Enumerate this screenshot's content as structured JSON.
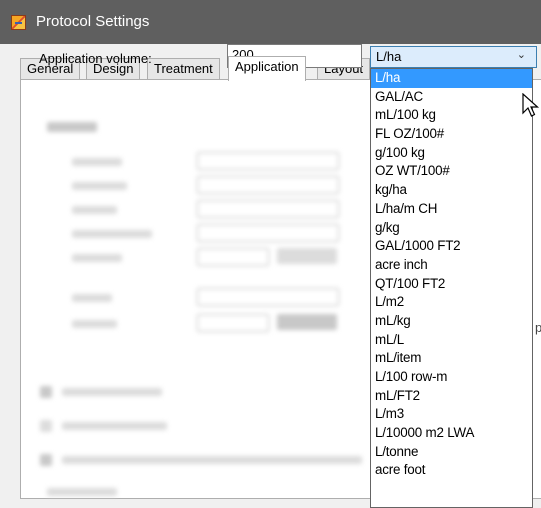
{
  "window": {
    "title": "Protocol Settings",
    "app_icon": "app-icon"
  },
  "tabs": [
    {
      "label": "General"
    },
    {
      "label": "Design"
    },
    {
      "label": "Treatment"
    },
    {
      "label": "Application",
      "active": true
    },
    {
      "label": "Layout"
    }
  ],
  "application": {
    "volume_label": "Application volume:",
    "volume_value": "200",
    "unit_selected": "L/ha",
    "unit_options": [
      "L/ha",
      "GAL/AC",
      "mL/100 kg",
      "FL OZ/100#",
      "g/100 kg",
      "OZ WT/100#",
      "kg/ha",
      "L/ha/m CH",
      "g/kg",
      "GAL/1000 FT2",
      "acre inch",
      "QT/100 FT2",
      "L/m2",
      "mL/kg",
      "mL/L",
      "mL/item",
      "L/100 row-m",
      "mL/FT2",
      "L/m3",
      "L/10000 m2 LWA",
      "L/tonne",
      "acre foot"
    ]
  },
  "colors": {
    "titlebar": "#5f5f5f",
    "selection": "#3399ff",
    "combo_focus": "#dcecfc"
  }
}
